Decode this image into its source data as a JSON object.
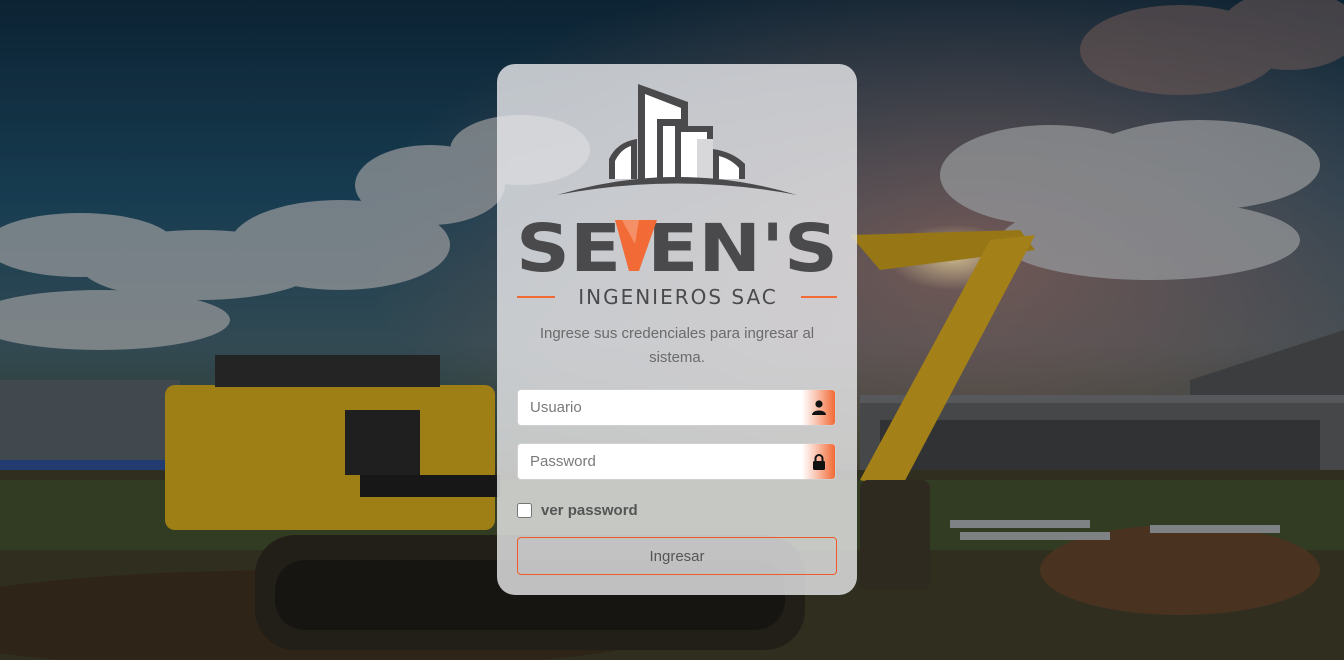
{
  "brand": {
    "name": "SEVEN'S",
    "tagline": "INGENIEROS SAC",
    "accent_color": "#f26a35",
    "dark_color": "#4a4a4c"
  },
  "login": {
    "subtitle": "Ingrese sus credenciales para ingresar al sistema.",
    "username_placeholder": "Usuario",
    "password_placeholder": "Password",
    "show_password_label": "ver password",
    "submit_label": "Ingresar"
  },
  "icons": {
    "username": "user-icon",
    "password": "lock-icon"
  }
}
